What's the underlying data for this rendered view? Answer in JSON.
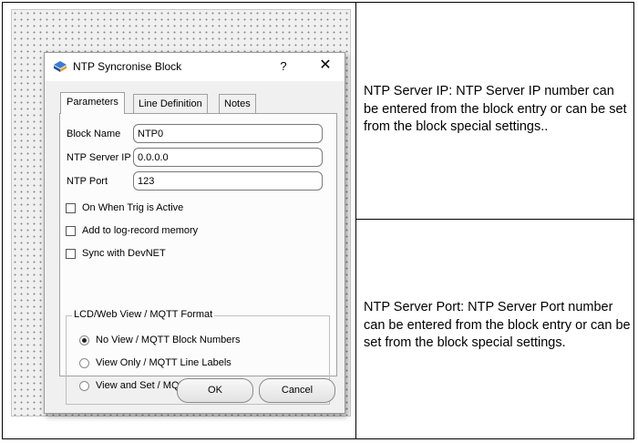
{
  "dialog": {
    "title": "NTP Syncronise Block",
    "help_label": "?",
    "close_label": "✕",
    "icon": "block-icon",
    "tabs": [
      {
        "label": "Parameters"
      },
      {
        "label": "Line Definition"
      },
      {
        "label": "Notes"
      }
    ],
    "fields": {
      "block_name": {
        "label": "Block Name",
        "value": "NTP0"
      },
      "server_ip": {
        "label": "NTP Server IP",
        "value": "0.0.0.0"
      },
      "port": {
        "label": "NTP Port",
        "value": "123"
      }
    },
    "checkboxes": [
      {
        "label": "On When Trig is Active",
        "checked": false
      },
      {
        "label": "Add to log-record memory",
        "checked": false
      },
      {
        "label": "Sync with DevNET",
        "checked": false
      }
    ],
    "group": {
      "title": "LCD/Web View / MQTT Format",
      "options": [
        {
          "label": "No View / MQTT Block Numbers",
          "selected": true
        },
        {
          "label": "View Only / MQTT Line Labels",
          "selected": false
        },
        {
          "label": "View and Set / MQTT Line Labels",
          "selected": false
        }
      ]
    },
    "ok_label": "OK",
    "cancel_label": "Cancel"
  },
  "notes": {
    "server_ip": "NTP Server IP: NTP Server IP number can be entered from the block entry or can be set from the block special settings..",
    "server_port": "NTP Server Port: NTP Server Port number can be entered from the block entry or can be set from the block special settings."
  },
  "colors": {
    "dialog_bg": "#f0f0f0",
    "panel_bg": "#fcfcfc",
    "icon_accent": "#3a7bd5"
  }
}
